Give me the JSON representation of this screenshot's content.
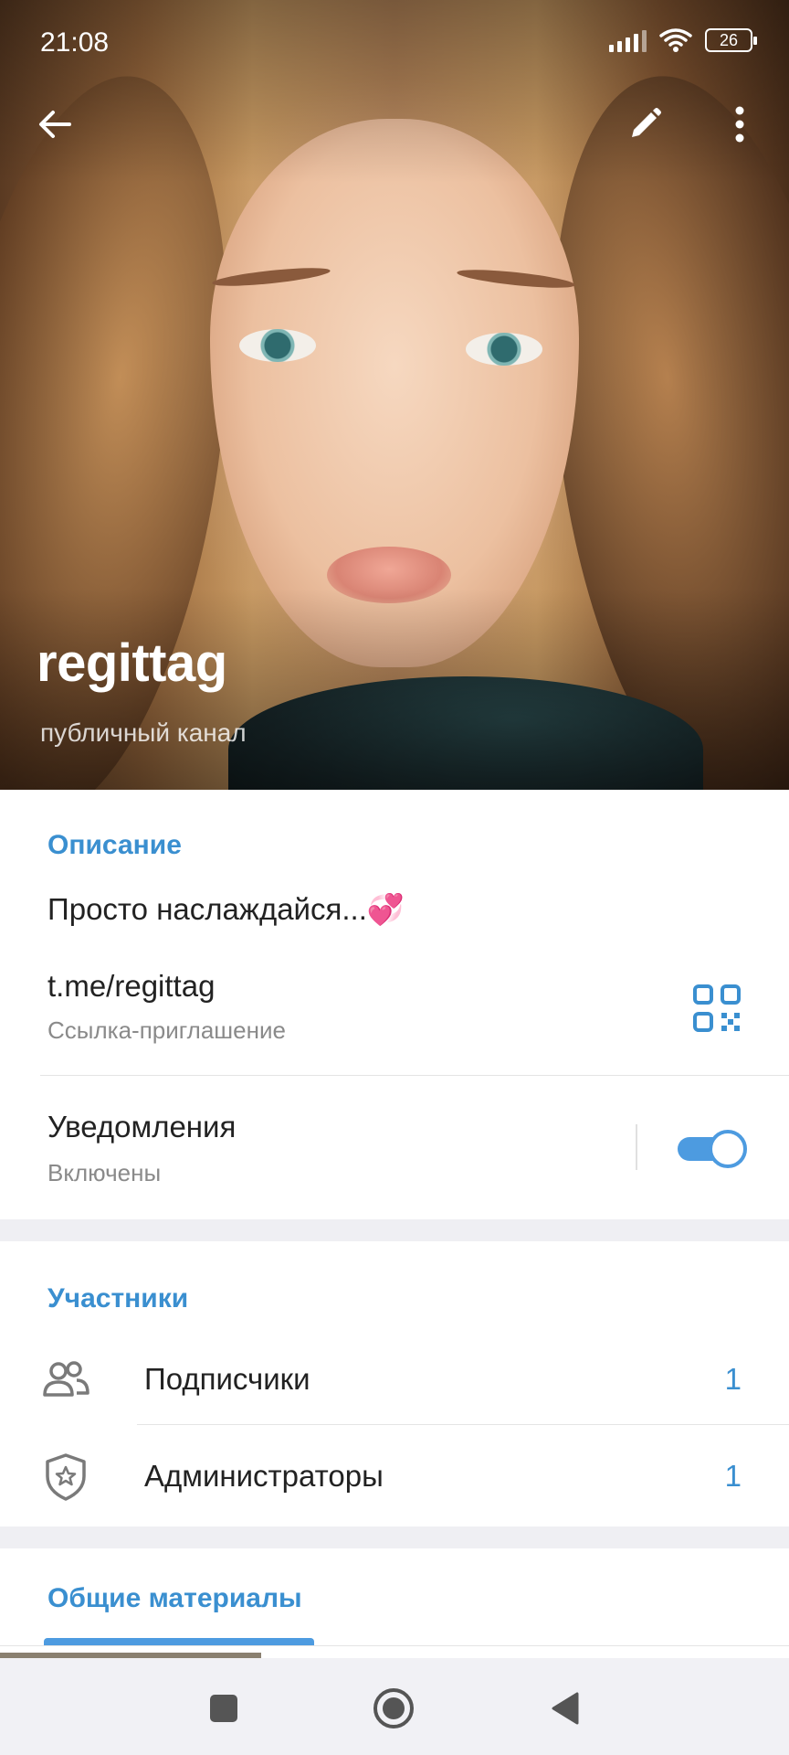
{
  "status_bar": {
    "time": "21:08",
    "battery": "26"
  },
  "header": {
    "channel_name": "regittag",
    "channel_type": "публичный канал"
  },
  "info": {
    "section_title": "Описание",
    "description": "Просто наслаждайся...💞",
    "link": "t.me/regittag",
    "link_label": "Ссылка-приглашение",
    "notifications_label": "Уведомления",
    "notifications_status": "Включены",
    "notifications_on": true
  },
  "members": {
    "section_title": "Участники",
    "items": [
      {
        "label": "Подписчики",
        "count": "1",
        "icon": "people-icon"
      },
      {
        "label": "Администраторы",
        "count": "1",
        "icon": "admin-shield-icon"
      }
    ]
  },
  "shared": {
    "section_title": "Общие материалы"
  },
  "colors": {
    "accent": "#3a8fd0",
    "toggle": "#4d9be0",
    "gap": "#efeff3"
  }
}
